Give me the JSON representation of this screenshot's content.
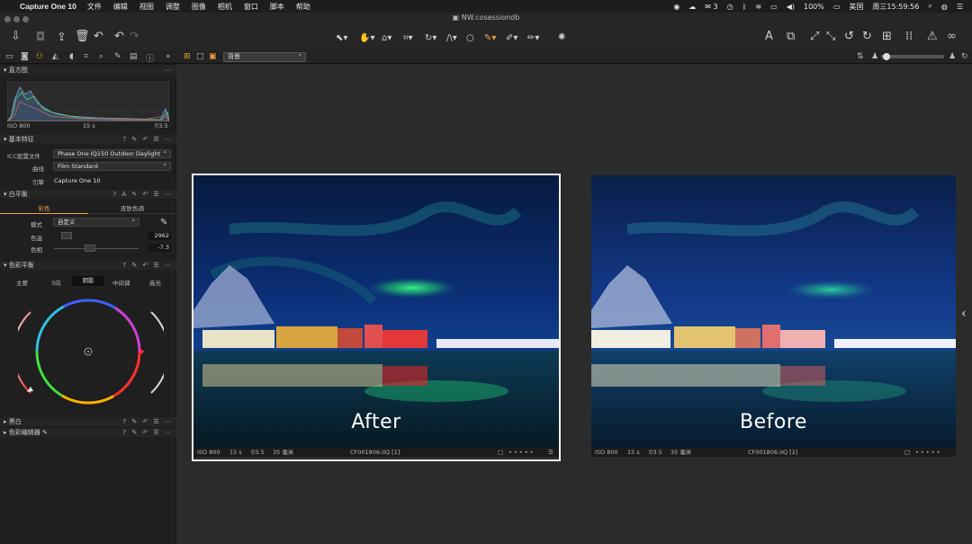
{
  "menubar": {
    "app_name": "Capture One 10",
    "items": [
      "文件",
      "编辑",
      "视图",
      "调整",
      "图像",
      "相机",
      "窗口",
      "脚本",
      "帮助"
    ],
    "status": {
      "notifications": "3",
      "battery": "100%",
      "input_source": "美国",
      "clock": "周三15:59:56"
    }
  },
  "window": {
    "title": "NW.cosessiondb"
  },
  "viewer_toolbar": {
    "preset_value": "背景"
  },
  "histogram": {
    "title": "直方图",
    "iso": "ISO 800",
    "shutter": "15 s",
    "aperture": "f/3.5"
  },
  "basic": {
    "title": "基本特征",
    "icc_label": "ICC配置文件",
    "icc_value": "Phase One IQ150 Outdoor Daylight",
    "curve_label": "曲线",
    "curve_value": "Film Standard",
    "engine_label": "引擎",
    "engine_value": "Capture One 10"
  },
  "white_balance": {
    "title": "白平衡",
    "tabs": [
      "彩色",
      "皮肤色调"
    ],
    "mode_label": "模式",
    "mode_value": "自定义",
    "temp_label": "色温",
    "temp_value": "2962",
    "tint_label": "色相",
    "tint_value": "-7.3"
  },
  "color_balance": {
    "title": "色彩平衡",
    "tabs": [
      "主要",
      "3向",
      "阴影",
      "中间调",
      "高光"
    ],
    "active_tab": "阴影"
  },
  "bw": {
    "title": "黑白"
  },
  "color_editor": {
    "title": "色彩编辑器"
  },
  "photos": [
    {
      "label": "After",
      "iso": "ISO 800",
      "shutter": "15 s",
      "aperture": "f/3.5",
      "focal": "35 毫米",
      "filename": "CF001806.IIQ [1]",
      "selected": true
    },
    {
      "label": "Before",
      "iso": "ISO 800",
      "shutter": "15 s",
      "aperture": "f/3.5",
      "focal": "35 毫米",
      "filename": "CF001806.IIQ [2]",
      "selected": false
    }
  ],
  "colors": {
    "accent": "#f0a040",
    "aurora": "#27d27a",
    "sky": "#0b2a6a"
  }
}
